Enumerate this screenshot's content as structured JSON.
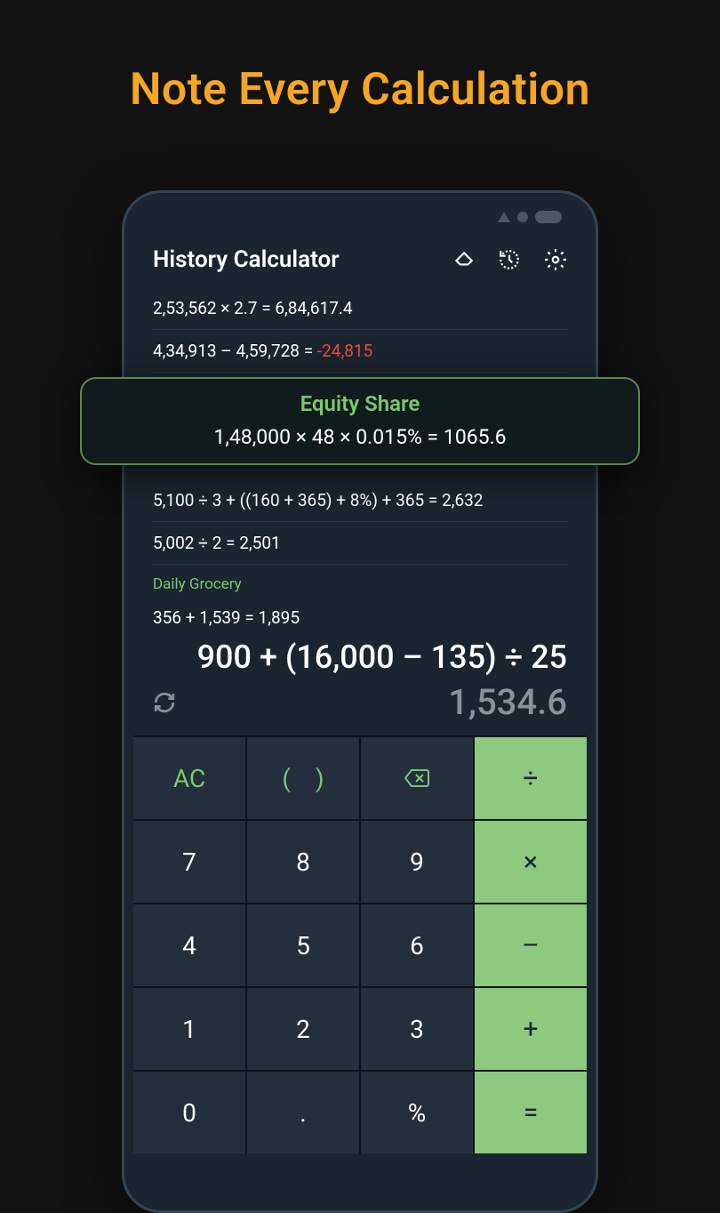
{
  "headline": "Note Every Calculation",
  "appTitle": "History Calculator",
  "history": {
    "r1": "2,53,562  ×  2.7  =  6,84,617.4",
    "r2a": "4,34,913  –  4,59,728  =  ",
    "r2b": "-24,815",
    "r4": "5,100  ÷  3  +  ((160  +  365)  +  8%)  +  365  =  2,632",
    "r5": "5,002  ÷  2  =  2,501",
    "note": "Daily Grocery",
    "r6": "356  +  1,539  =  1,895"
  },
  "callout": {
    "title": "Equity Share",
    "expr": "1,48,000  ×  48  ×  0.015%  =  1065.6"
  },
  "current": {
    "expr": "900 + (16,000 – 135) ÷ 25",
    "result": "1,534.6"
  },
  "keys": {
    "ac": "AC",
    "lp": "(",
    "rp": ")",
    "div": "÷",
    "mul": "×",
    "sub": "–",
    "add": "+",
    "eq": "=",
    "k7": "7",
    "k8": "8",
    "k9": "9",
    "k4": "4",
    "k5": "5",
    "k6": "6",
    "k1": "1",
    "k2": "2",
    "k3": "3",
    "k0": "0",
    "dot": ".",
    "pct": "%"
  }
}
